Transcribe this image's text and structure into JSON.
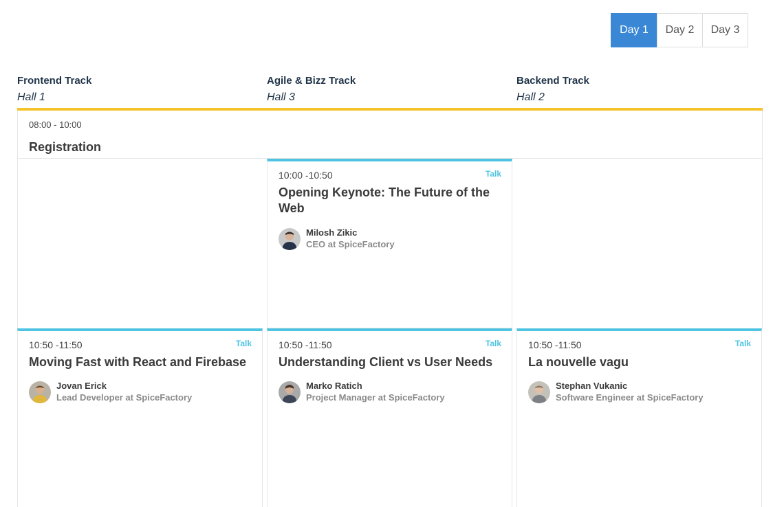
{
  "day_tabs": [
    {
      "label": "Day 1",
      "active": true
    },
    {
      "label": "Day 2",
      "active": false
    },
    {
      "label": "Day 3",
      "active": false
    }
  ],
  "tracks": [
    {
      "name": "Frontend Track",
      "hall": "Hall 1"
    },
    {
      "name": "Agile & Bizz Track",
      "hall": "Hall 3"
    },
    {
      "name": "Backend Track",
      "hall": "Hall 2"
    }
  ],
  "registration": {
    "time": "08:00 - 10:00",
    "title": "Registration"
  },
  "sessions": {
    "keynote": {
      "time": "10:00 -10:50",
      "tag": "Talk",
      "title": "Opening Keynote: The Future of the Web",
      "speaker_name": "Milosh Zikic",
      "speaker_role": "CEO at SpiceFactory"
    },
    "frontend": {
      "time": "10:50 -11:50",
      "tag": "Talk",
      "title": "Moving Fast with React and Firebase",
      "speaker_name": "Jovan Erick",
      "speaker_role": "Lead Developer at SpiceFactory"
    },
    "agile": {
      "time": "10:50 -11:50",
      "tag": "Talk",
      "title": "Understanding Client vs User Needs",
      "speaker_name": "Marko Ratich",
      "speaker_role": "Project Manager at SpiceFactory"
    },
    "backend": {
      "time": "10:50 -11:50",
      "tag": "Talk",
      "title": "La nouvelle vagu",
      "speaker_name": "Stephan Vukanic",
      "speaker_role": "Software Engineer at SpiceFactory"
    }
  },
  "colors": {
    "accent_blue": "#3a87d6",
    "track_line": "#f5c32c",
    "talk_cyan": "#4ec4e2"
  }
}
